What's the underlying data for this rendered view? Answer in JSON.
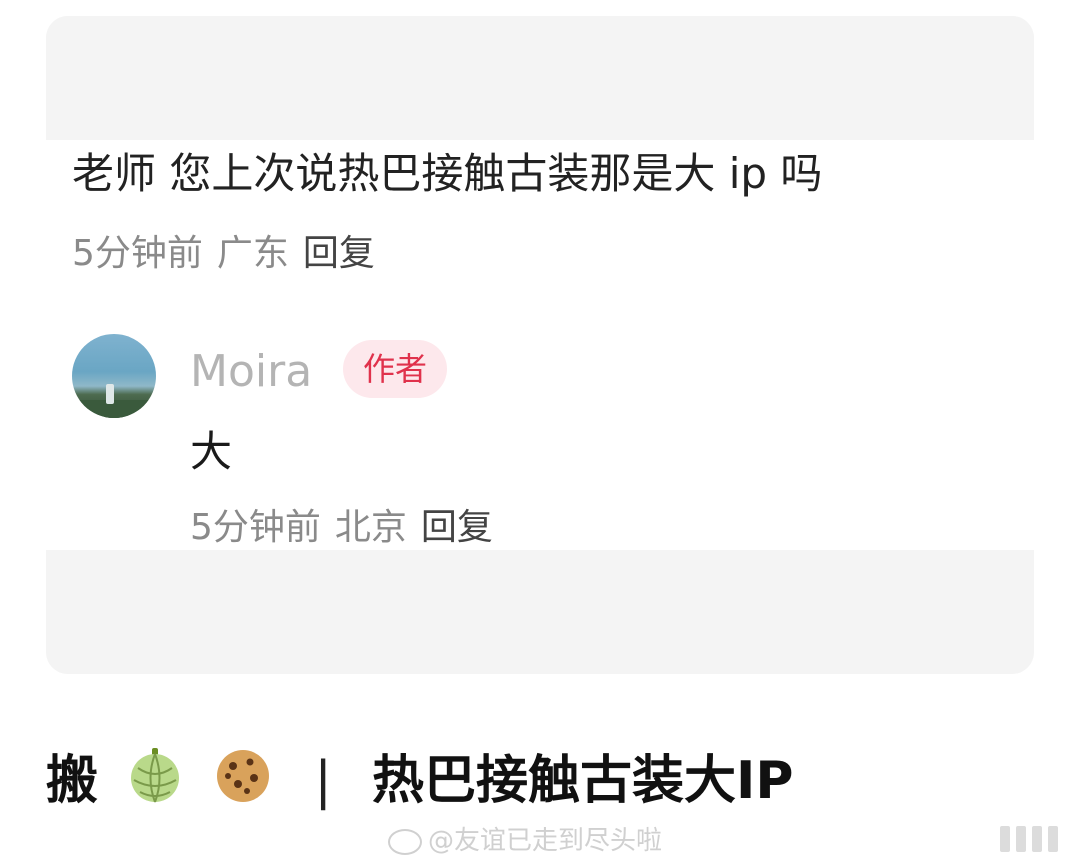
{
  "comment": {
    "text": "老师 您上次说热巴接触古装那是大 ip 吗",
    "time": "5分钟前",
    "location": "广东",
    "reply_label": "回复"
  },
  "reply": {
    "author": "Moira",
    "badge": "作者",
    "text": "大",
    "time": "5分钟前",
    "location": "北京",
    "reply_label": "回复"
  },
  "caption": {
    "prefix": "搬",
    "emoji_1": "melon-icon",
    "emoji_2": "cookie-icon",
    "separator": "|",
    "title": "热巴接触古装大IP"
  },
  "watermark": "@友谊已走到尽头啦",
  "colors": {
    "badge_bg": "#fde8ec",
    "badge_text": "#e0324c",
    "meta_text": "#8a8a8a",
    "author_name": "#b4b4b4"
  }
}
